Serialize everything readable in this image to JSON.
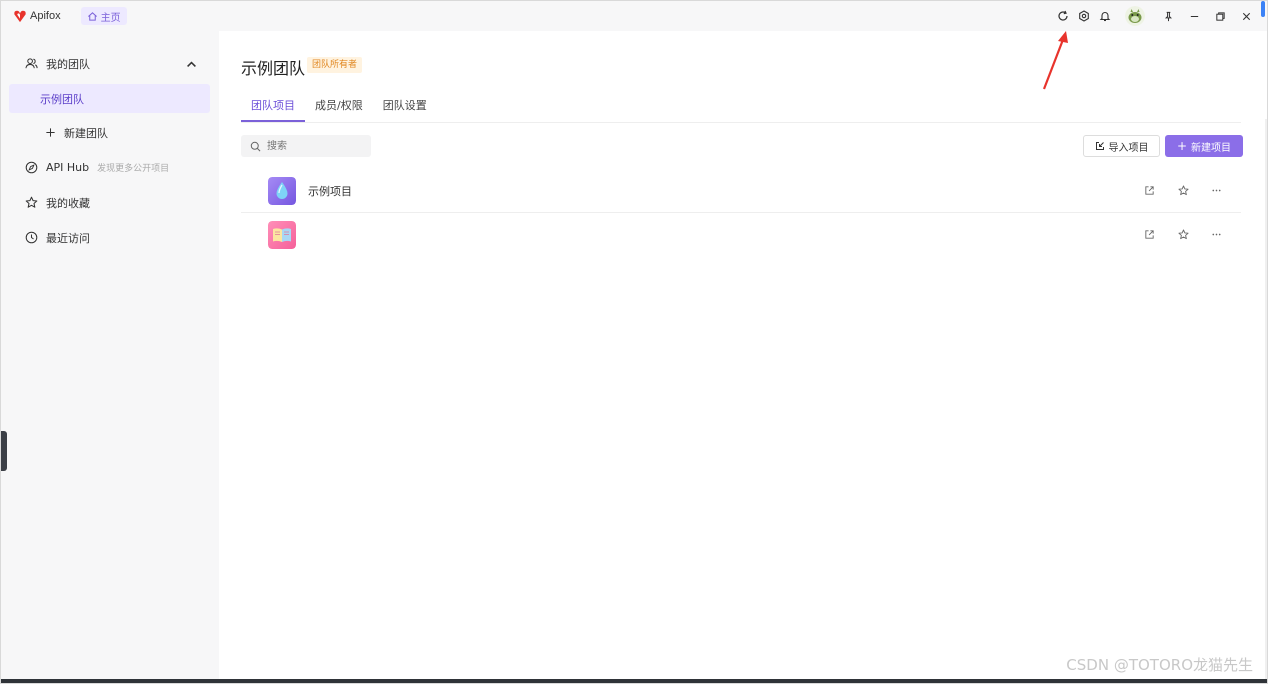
{
  "titlebar": {
    "app_name": "Apifox",
    "home_tab_label": "主页",
    "icons": [
      "sync-icon",
      "settings-icon",
      "bell-icon",
      "avatar",
      "pin-icon",
      "minimize-icon",
      "restore-icon",
      "close-icon"
    ]
  },
  "sidebar": {
    "my_team": "我的团队",
    "active_team": "示例团队",
    "new_team": "新建团队",
    "api_hub": "API Hub",
    "api_hub_sub": "发现更多公开项目",
    "favorites": "我的收藏",
    "recent": "最近访问"
  },
  "main": {
    "title": "示例团队",
    "owner_badge": "团队所有者",
    "tabs": [
      {
        "label": "团队项目",
        "active": true
      },
      {
        "label": "成员/权限",
        "active": false
      },
      {
        "label": "团队设置",
        "active": false
      }
    ],
    "search_placeholder": "搜索",
    "import_label": "导入项目",
    "new_label": "新建项目",
    "projects": [
      {
        "name": "示例项目",
        "icon": "droplet-icon"
      },
      {
        "name": "",
        "icon": "book-icon"
      }
    ]
  },
  "watermark": "CSDN @TOTORO龙猫先生",
  "colors": {
    "accent": "#7b61d9",
    "primary_button": "#8b6ee8",
    "badge_text": "#e0861f",
    "annotation_arrow": "#e8332c"
  }
}
